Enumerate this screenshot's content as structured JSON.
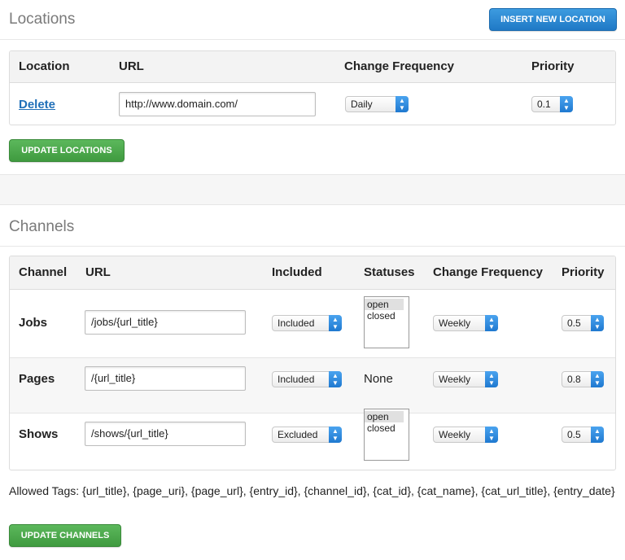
{
  "locations": {
    "title": "Locations",
    "insert_button": "Insert New Location",
    "headers": [
      "Location",
      "URL",
      "Change Frequency",
      "Priority"
    ],
    "rows": [
      {
        "action": "Delete",
        "url": "http://www.domain.com/",
        "frequency": "Daily",
        "priority": "0.1"
      }
    ],
    "update_button": "Update Locations"
  },
  "channels": {
    "title": "Channels",
    "headers": [
      "Channel",
      "URL",
      "Included",
      "Statuses",
      "Change Frequency",
      "Priority"
    ],
    "rows": [
      {
        "name": "Jobs",
        "url": "/jobs/{url_title}",
        "included": "Included",
        "statuses": [
          "open",
          "closed"
        ],
        "frequency": "Weekly",
        "priority": "0.5"
      },
      {
        "name": "Pages",
        "url": "/{url_title}",
        "included": "Included",
        "statuses_text": "None",
        "frequency": "Weekly",
        "priority": "0.8"
      },
      {
        "name": "Shows",
        "url": "/shows/{url_title}",
        "included": "Excluded",
        "statuses": [
          "open",
          "closed"
        ],
        "frequency": "Weekly",
        "priority": "0.5"
      }
    ],
    "allowed_tags": "Allowed Tags: {url_title}, {page_uri}, {page_url}, {entry_id}, {channel_id}, {cat_id}, {cat_name}, {cat_url_title}, {entry_date}",
    "update_button": "Update Channels"
  },
  "icons": {
    "select_arrows": "up-down-chevron-icon"
  },
  "colors": {
    "blue_button": "#1f79c6",
    "green_button": "#3f9a3f",
    "link": "#1f6fb8"
  }
}
